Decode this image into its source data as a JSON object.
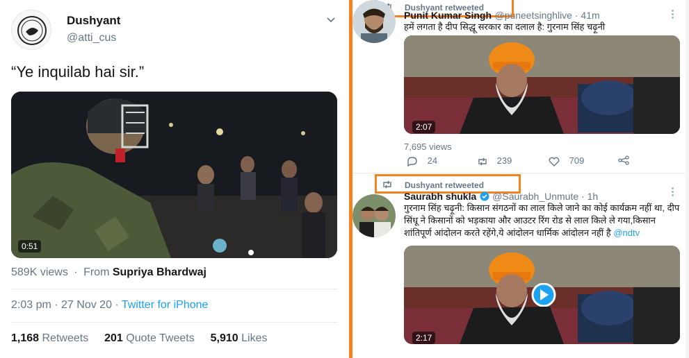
{
  "left_tweet": {
    "display_name": "Dushyant",
    "handle": "@atti_cus",
    "text": "“Ye inquilab hai sir.”",
    "video_duration": "0:51",
    "views": "589K views",
    "from_label": "From",
    "from_user": "Supriya Bhardwaj",
    "time": "2:03 pm · 27 Nov 20 · ",
    "source": "Twitter for iPhone",
    "retweets_count": "1,168",
    "retweets_label": "Retweets",
    "quote_count": "201",
    "quote_label": "Quote Tweets",
    "likes_count": "5,910",
    "likes_label": "Likes"
  },
  "right_tweets": [
    {
      "retweeted_by": "Dushyant retweeted",
      "name": "Punit Kumar Singh",
      "handle_time": "@puneetsinghlive · 41m",
      "text": "हमें लगता है दीप सिद्धू सरकार का दलाल है: गुरनाम सिंह चढ़ूनी",
      "video_duration": "2:07",
      "views": "7,695 views",
      "replies": "24",
      "retweets": "239",
      "likes": "709"
    },
    {
      "retweeted_by": "Dushyant retweeted",
      "name": "Saurabh shukla",
      "handle_time": "@Saurabh_Unmute · 1h",
      "text": "गुरनाम सिंह चढ़ूनी: किसान संगठनों का लाल किले जाने का कोई कार्यक्रम नहीं था, दीप सिंधू ने किसानों को भड़काया और आउटर रिंग रोड से लाल किले ले गया,किसान शांतिपूर्ण आंदोलन करते रहेंगे,ये आंदोलन धार्मिक आंदोलन नहीं है",
      "mention": "@ndtv",
      "video_duration": "2:17"
    }
  ],
  "colors": {
    "highlight": "#f58220",
    "link": "#1da1f2",
    "muted": "#657786"
  }
}
